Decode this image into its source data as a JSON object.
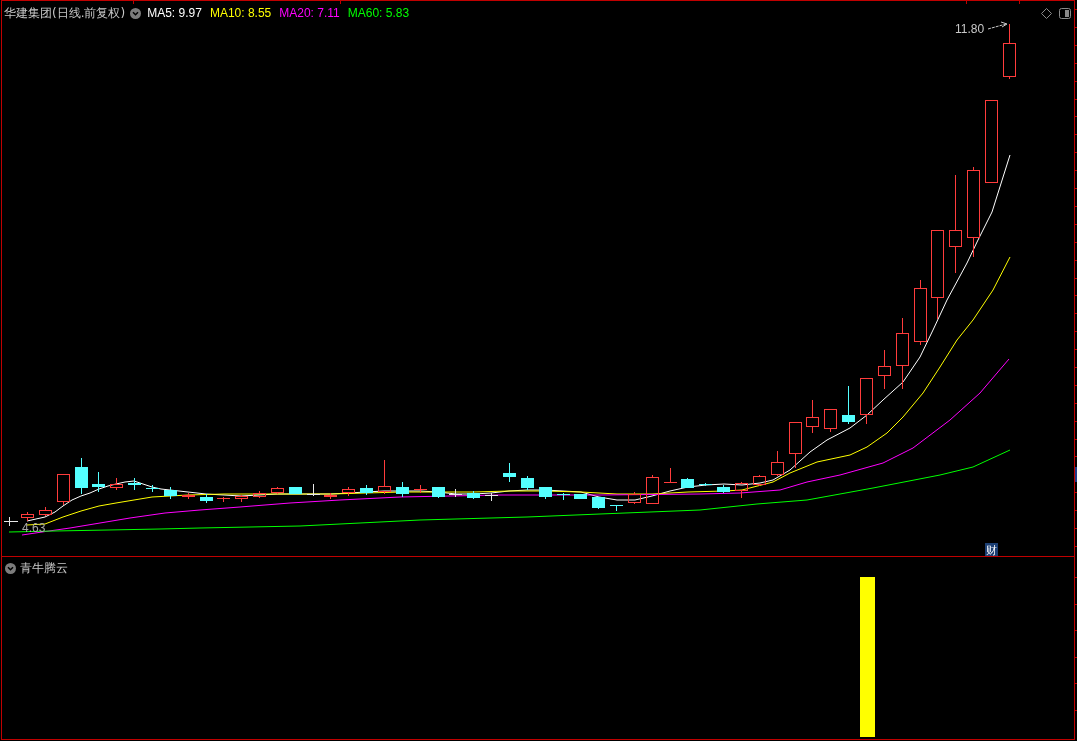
{
  "header": {
    "title": "华建集团(日线.前复权)",
    "legend": [
      {
        "text": "MA5: 9.97",
        "color": "#ffffff"
      },
      {
        "text": "MA10: 8.55",
        "color": "#ffff00"
      },
      {
        "text": "MA20: 7.11",
        "color": "#ff00ff"
      },
      {
        "text": "MA60: 5.83",
        "color": "#00ff00"
      }
    ]
  },
  "price_chart": {
    "high_label": "11.80",
    "low_label": "4.63",
    "badge": "财"
  },
  "indicator_panel": {
    "title": "青牛腾云"
  }
}
